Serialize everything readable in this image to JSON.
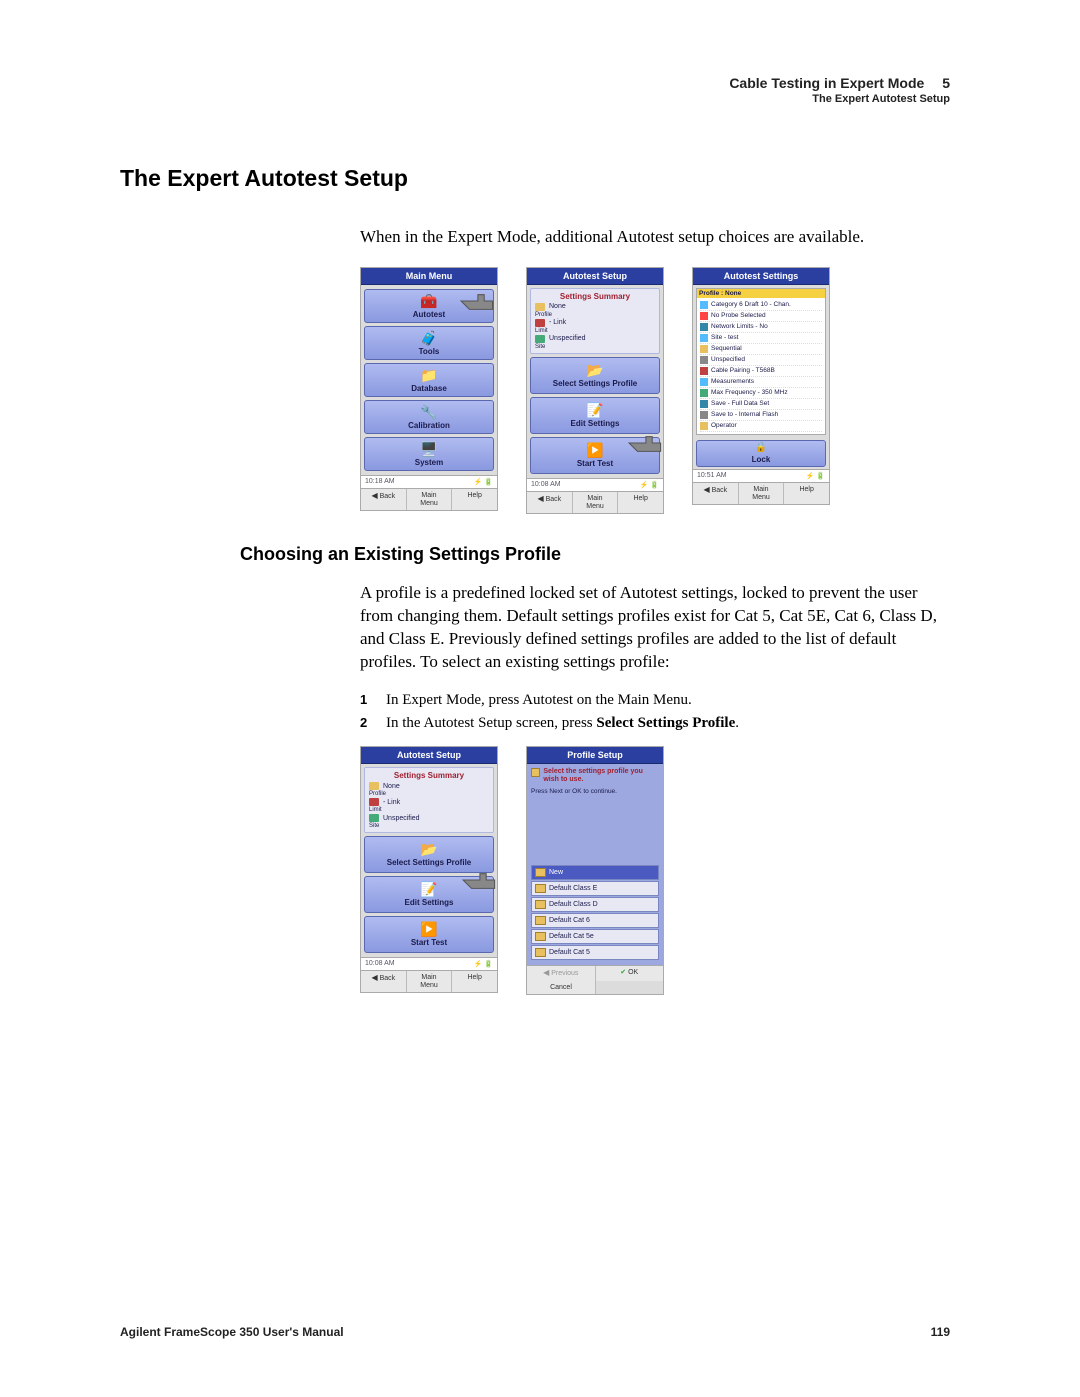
{
  "header": {
    "chapter_title": "Cable Testing in Expert Mode",
    "chapter_num": "5",
    "sub": "The Expert Autotest Setup"
  },
  "section_title": "The Expert Autotest Setup",
  "intro": "When in the Expert Mode, additional Autotest setup choices are available.",
  "main_menu": {
    "title": "Main Menu",
    "items": [
      "Autotest",
      "Tools",
      "Database",
      "Calibration",
      "System"
    ],
    "time": "10:18 AM",
    "back": "Back",
    "menu": "Main\nMenu",
    "help": "Help"
  },
  "autotest_setup": {
    "title": "Autotest Setup",
    "summary_title": "Settings Summary",
    "rows": [
      {
        "l": "Profile",
        "v": "None"
      },
      {
        "l": "Limit",
        "v": "- Link"
      },
      {
        "l": "Site",
        "v": "Unspecified"
      }
    ],
    "btns": [
      "Select Settings Profile",
      "Edit Settings",
      "Start Test"
    ],
    "time": "10:08 AM",
    "back": "Back",
    "menu": "Main\nMenu",
    "help": "Help"
  },
  "autotest_settings": {
    "title": "Autotest Settings",
    "hdr": "Profile : None",
    "items": [
      "Category 6 Draft 10 - Chan.",
      "No Probe Selected",
      "Network Limits - No",
      "Site - test",
      "Sequential",
      "Unspecified",
      "Cable Pairing - T568B",
      "Measurements",
      "Max Frequency - 350 MHz",
      "Save - Full Data Set",
      "Save to - Internal Flash",
      "Operator"
    ],
    "lock": "Lock",
    "time": "10:51 AM",
    "back": "Back",
    "menu": "Main\nMenu",
    "help": "Help"
  },
  "subsection_title": "Choosing an Existing Settings Profile",
  "subsection_body": "A profile is a predefined locked set of Autotest settings, locked to prevent the user from changing them. Default settings profiles exist for Cat 5, Cat 5E, Cat 6, Class D, and Class E. Previously defined settings profiles are added to the list of default profiles. To select an existing settings profile:",
  "steps": [
    {
      "n": "1",
      "t": "In Expert Mode, press Autotest on the Main Menu."
    },
    {
      "n": "2",
      "t_pre": "In the Autotest Setup screen, press ",
      "t_bold": "Select Settings Profile",
      "t_post": "."
    }
  ],
  "profile_setup": {
    "title": "Profile Setup",
    "msg": "Select the settings profile you wish to use.",
    "msg2": "Press Next or OK to continue.",
    "items": [
      "New",
      "Default Class E",
      "Default Class D",
      "Default Cat 6",
      "Default Cat 5e",
      "Default Cat 5"
    ],
    "prev": "Previous",
    "ok": "OK",
    "cancel": "Cancel"
  },
  "footer": {
    "left": "Agilent FrameScope 350 User's Manual",
    "right": "119"
  }
}
